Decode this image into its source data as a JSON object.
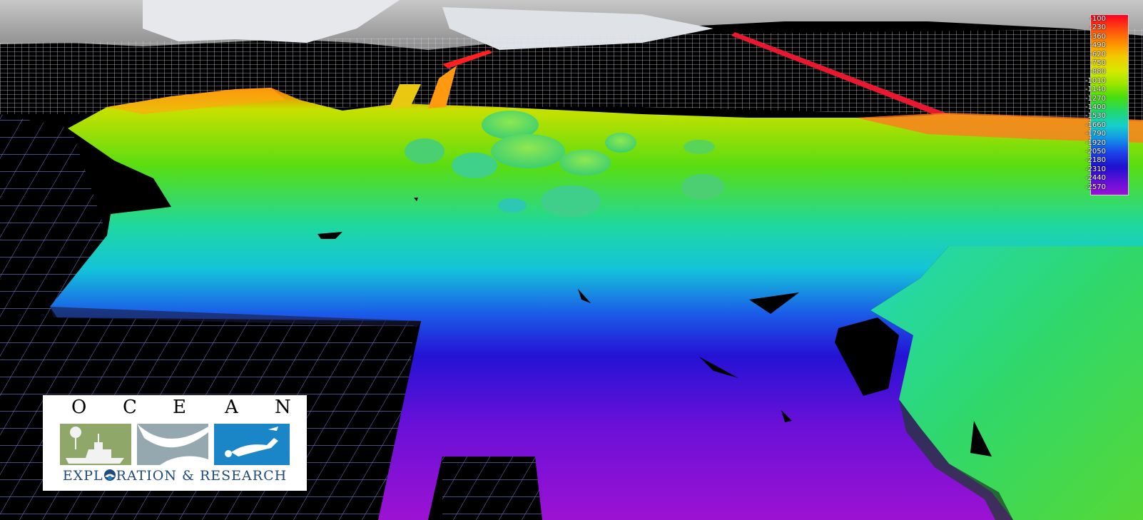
{
  "legend": {
    "ticks": [
      "-100",
      "-230",
      "-360",
      "-490",
      "-620",
      "-750",
      "-880",
      "-1010",
      "-1140",
      "-1270",
      "-1400",
      "-1530",
      "-1660",
      "-1790",
      "-1920",
      "-2050",
      "-2180",
      "-2310",
      "-2440",
      "-2570"
    ],
    "colors": [
      "#ff0022",
      "#ff4a10",
      "#ff8c00",
      "#f2c800",
      "#d8e800",
      "#9ae600",
      "#45dd10",
      "#20d870",
      "#16cfcb",
      "#1290e8",
      "#1c40e8",
      "#2010d0",
      "#6010d8",
      "#9b10d6"
    ]
  },
  "logo": {
    "letters": [
      "O",
      "C",
      "E",
      "A",
      "N"
    ],
    "subtitle_parts": [
      "EXPL",
      "RATION & RESEARCH"
    ],
    "colors": {
      "navy": "#1f4a7c",
      "green": "#8fa86a",
      "grey": "#95a8b0",
      "blue": "#1a86c8"
    }
  },
  "icons": {
    "panel1": "ship-and-balloon-icon",
    "panel2": "wave-crest-icon",
    "panel3": "diver-icon",
    "noaa": "noaa-emblem-icon"
  }
}
